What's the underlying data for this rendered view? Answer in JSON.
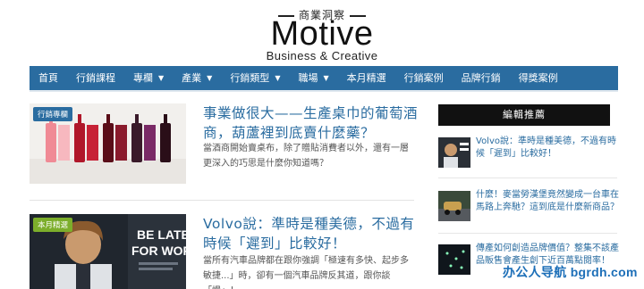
{
  "brand": {
    "top_text": "商業洞察",
    "name": "Motive",
    "tagline": "Business & Creative"
  },
  "nav": {
    "items": [
      {
        "label": "首頁",
        "dropdown": false
      },
      {
        "label": "行銷課程",
        "dropdown": false
      },
      {
        "label": "專欄",
        "dropdown": true
      },
      {
        "label": "產業",
        "dropdown": true
      },
      {
        "label": "行銷類型",
        "dropdown": true
      },
      {
        "label": "職場",
        "dropdown": true
      },
      {
        "label": "本月精選",
        "dropdown": false
      },
      {
        "label": "行銷案例",
        "dropdown": false
      },
      {
        "label": "品牌行銷",
        "dropdown": false
      },
      {
        "label": "得獎案例",
        "dropdown": false
      }
    ],
    "caret": "chevron-down-icon"
  },
  "articles": [
    {
      "tag": "行銷專欄",
      "tag_color": "#2a6ca0",
      "title": "事業做很大——生產桌巾的葡萄酒商，葫蘆裡到底賣什麼藥？",
      "excerpt": "當酒商開始賣桌布，除了贈貼消費者以外，還有一層更深入的巧思是什麼你知道嗎？"
    },
    {
      "tag": "本月精選",
      "tag_color": "#7cae2b",
      "title": "Volvo說：準時是種美德，不過有時候「遲到」比較好！",
      "excerpt": "當所有汽車品牌都在跟你強調「極速有多快、起步多敏捷...」時，卻有一個汽車品牌反其道，跟你談「慢」！",
      "image_text": "BE LATE FOR WORK"
    }
  ],
  "sidebar": {
    "title": "編輯推薦",
    "items": [
      {
        "text": "Volvo說：準時是種美德，不過有時候「遲到」比較好！"
      },
      {
        "text": "什麼！麥當勞漢堡竟然變成一台車在馬路上奔馳？這到底是什麼新商品？"
      },
      {
        "text": "傳產如何創造品牌價值？整集不該產品販售會產生創下近百萬點閱率！"
      }
    ]
  },
  "watermark": "办公人导航 bgrdh.com"
}
